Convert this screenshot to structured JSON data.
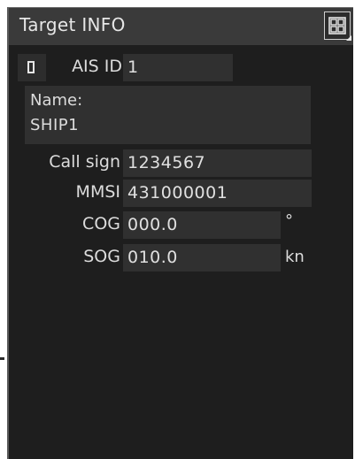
{
  "window": {
    "title": "Target INFO",
    "layout_button_icon": "grid-layout-icon"
  },
  "ais": {
    "checkbox_icon": "checkbox-icon",
    "id_label": "AIS ID",
    "id_value": "1"
  },
  "name": {
    "label": "Name:",
    "value": "SHIP1"
  },
  "fields": {
    "call_sign": {
      "label": "Call sign",
      "value": "1234567"
    },
    "mmsi": {
      "label": "MMSI",
      "value": "431000001"
    },
    "cog": {
      "label": "COG",
      "value": "000.0",
      "unit": "°"
    },
    "sog": {
      "label": "SOG",
      "value": "010.0",
      "unit": "kn"
    }
  },
  "colors": {
    "panel_background": "#1e1e1e",
    "title_bar": "#3a3a3a",
    "field_background": "#303030",
    "text": "#e0e0e0"
  }
}
